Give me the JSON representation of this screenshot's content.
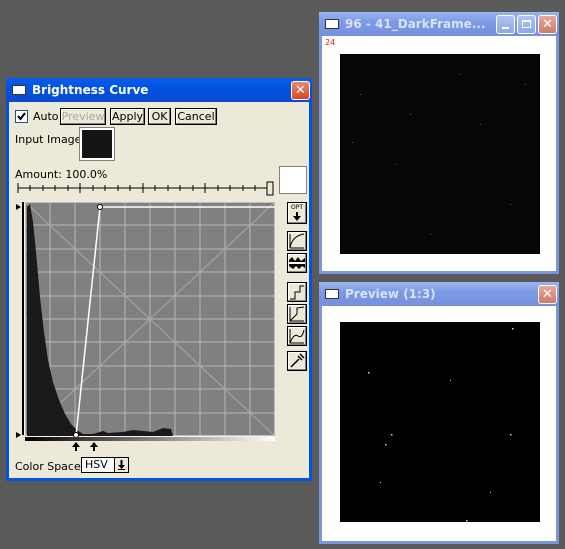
{
  "brightness_window": {
    "title": "Brightness Curve",
    "auto_label": "Auto",
    "auto_checked": true,
    "buttons": {
      "preview": "Preview",
      "apply": "Apply",
      "ok": "OK",
      "cancel": "Cancel"
    },
    "input_image_label": "Input Image:",
    "amount_label": "Amount: 100.0%",
    "opt_label": "OPT",
    "color_space_label": "Color Space:",
    "color_space_value": "HSV"
  },
  "frame_window": {
    "title": "96 - 41_DarkFrame...",
    "counter": "24"
  },
  "preview_window": {
    "title": "Preview (1:3)"
  }
}
